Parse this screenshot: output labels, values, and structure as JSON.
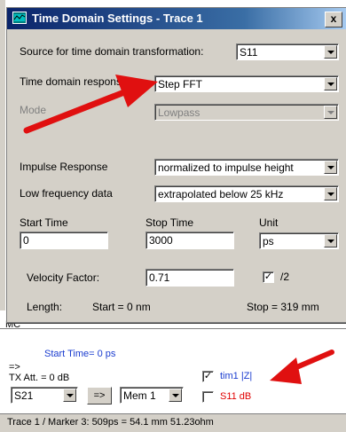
{
  "dialog": {
    "title": "Time Domain Settings - Trace 1",
    "close_label": "x",
    "source_label": "Source for time domain transformation:",
    "source_value": "S11",
    "response_label": "Time domain response",
    "response_value": "Step FFT",
    "mode_label": "Mode",
    "mode_value": "Lowpass",
    "impulse_label": "Impulse Response",
    "impulse_value": "normalized to impulse height",
    "lowfreq_label": "Low frequency data",
    "lowfreq_value": "extrapolated below 25 kHz",
    "start_time_label": "Start Time",
    "start_time_value": "0",
    "stop_time_label": "Stop Time",
    "stop_time_value": "3000",
    "unit_label": "Unit",
    "unit_value": "ps",
    "velocity_label": "Velocity Factor:",
    "velocity_value": "0.71",
    "half_label": "/2",
    "half_checked": true,
    "length_label": "Length:",
    "length_start": "Start = 0 nm",
    "length_stop": "Stop = 319 mm"
  },
  "background": {
    "mc_label": "MC",
    "start_time_text": "Start Time= 0 ps",
    "arrow_text": "=>",
    "tx_att": "TX Att.  = 0 dB",
    "param_select": "S21",
    "arrow_button": "=>",
    "mem_select": "Mem 1",
    "trace1_label": "tim1  |Z|",
    "trace2_label": "S11  dB",
    "status_text": "Trace 1 / Marker 3:   509ps = 54.1 mm       51.23ohm"
  },
  "colors": {
    "title_bar": "#0a246a",
    "annotation_arrow": "#e01010",
    "trace_blue": "#1a3ccf",
    "trace_red": "#e00000"
  },
  "icons": [
    "window-app-icon",
    "close-icon",
    "dropdown-arrow-icon",
    "annotation-arrow"
  ]
}
